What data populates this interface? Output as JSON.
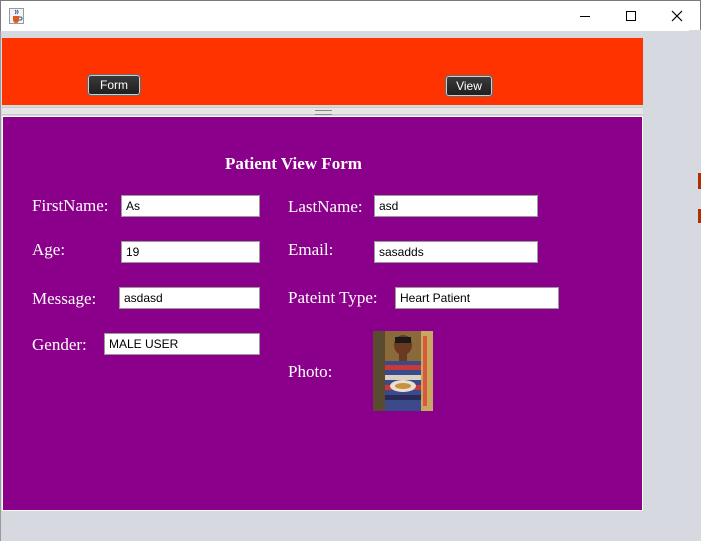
{
  "nav": {
    "form_label": "Form",
    "view_label": "View"
  },
  "form": {
    "title": "Patient View Form",
    "labels": {
      "first_name": "FirstName:",
      "last_name": "LastName:",
      "age": "Age:",
      "email": "Email:",
      "message": "Message:",
      "patient_type": "Pateint Type:",
      "gender": "Gender:",
      "photo": "Photo:"
    },
    "values": {
      "first_name": "As",
      "last_name": "asd",
      "age": "19",
      "email": "sasadds",
      "message": "asdasd",
      "patient_type": "Heart Patient",
      "gender": "MALE USER"
    }
  },
  "colors": {
    "top_panel": "#ff3300",
    "main_panel": "#8b008b"
  },
  "icons": {
    "app": "java-cup-icon",
    "minimize": "minimize-icon",
    "maximize": "maximize-icon",
    "close": "close-icon"
  }
}
